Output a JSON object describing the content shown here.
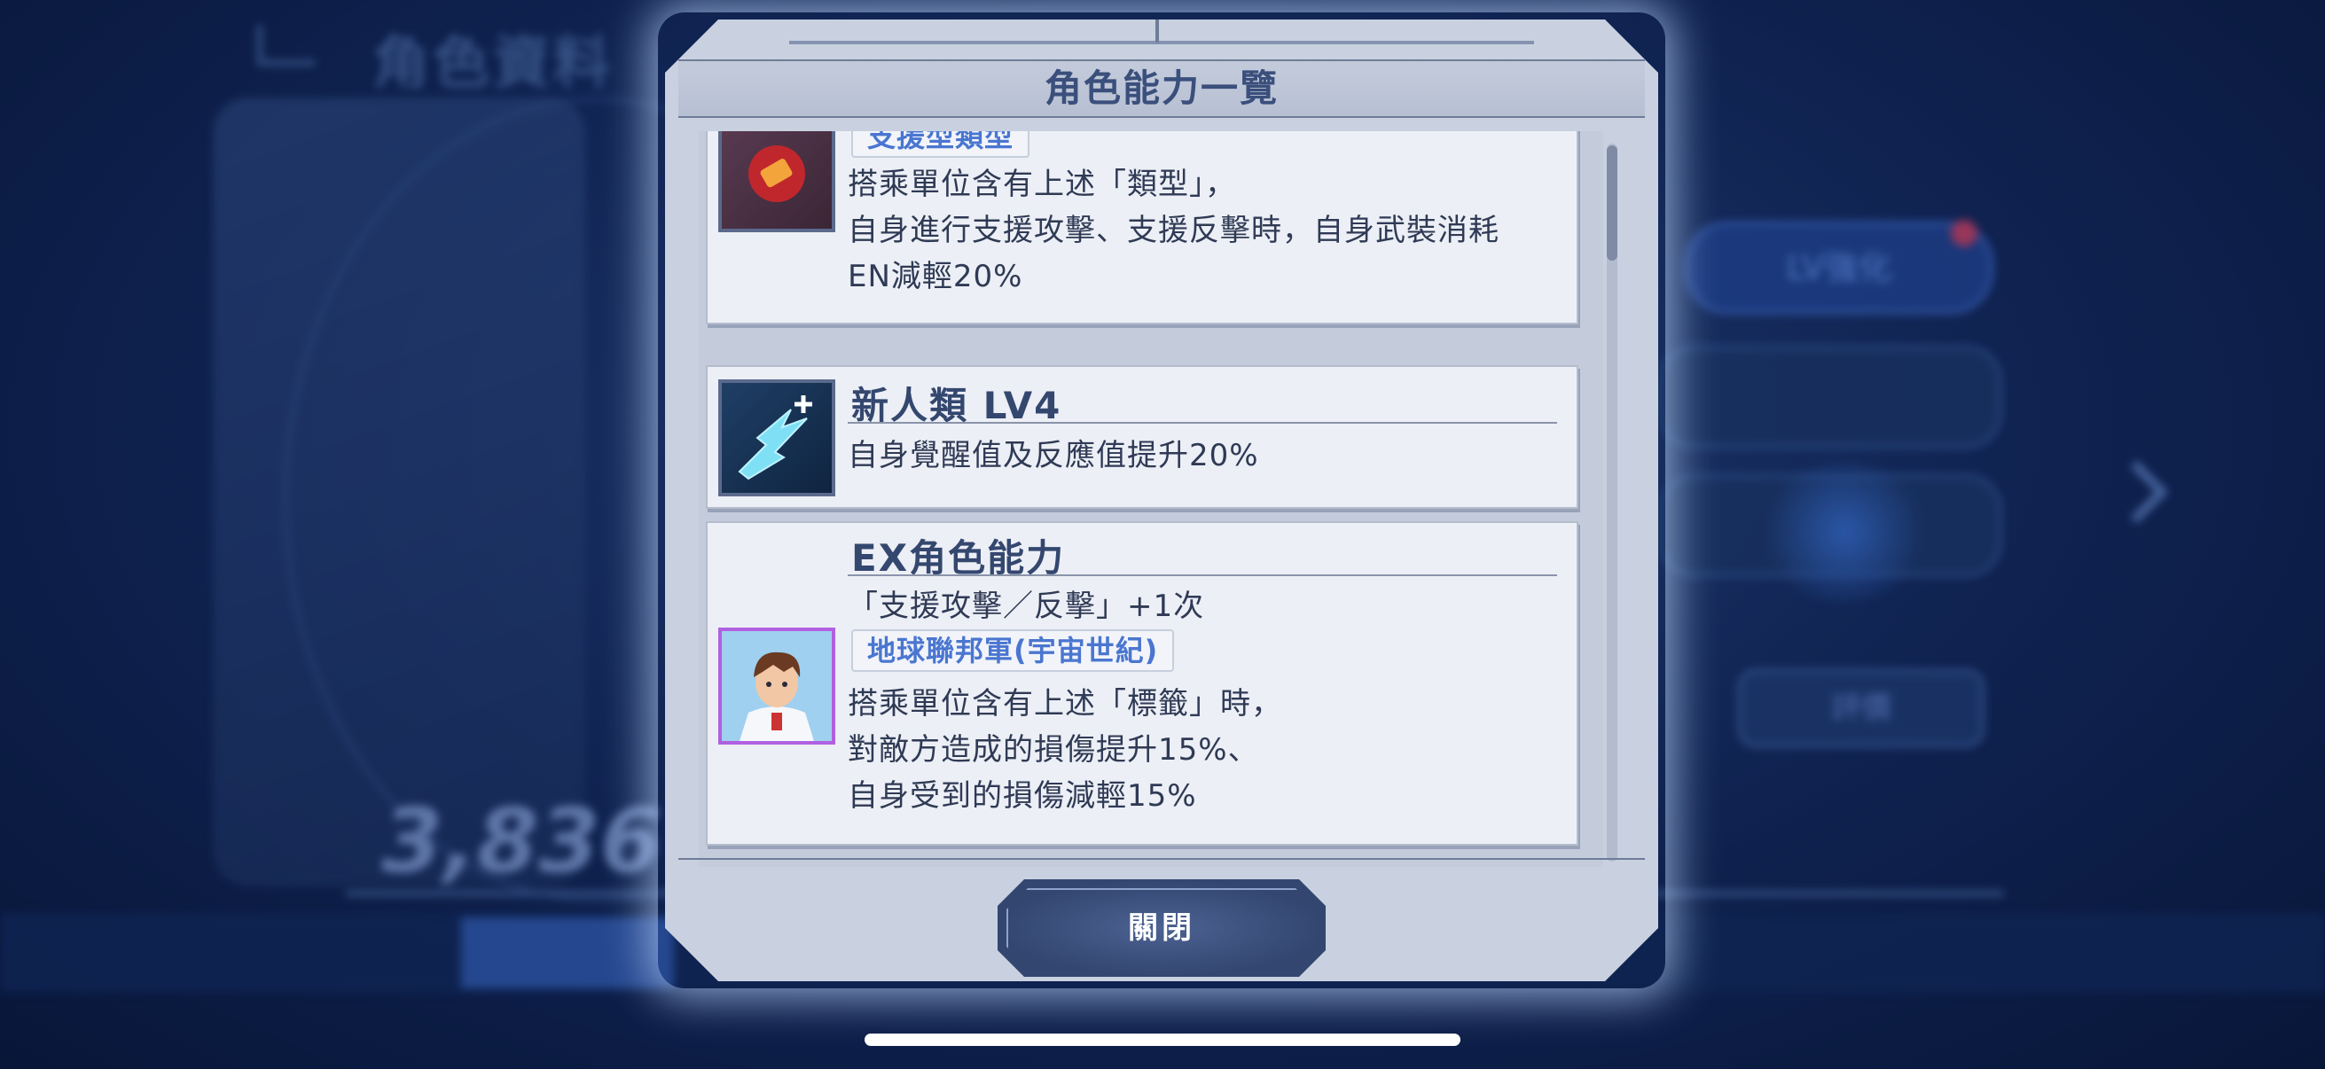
{
  "background": {
    "title": "角色資料",
    "power_value": "3,836",
    "lv_button": "LV強化",
    "search_button": "評價"
  },
  "dialog": {
    "title": "角色能力一覽",
    "close_label": "關閉",
    "abilities": [
      {
        "icon": "support-type-icon",
        "tag": "支援型類型",
        "lines": [
          "搭乘單位含有上述「類型」，",
          "自身進行支援攻擊、支援反擊時，自身武裝消耗",
          "EN減輕20%"
        ]
      },
      {
        "icon": "newtype-icon",
        "title": "新人類 LV4",
        "lines": [
          "自身覺醒值及反應值提升20%"
        ]
      },
      {
        "icon": "character-portrait-icon",
        "title": "EX角色能力",
        "line_before_tag": "「支援攻擊／反擊」+1次",
        "tag": "地球聯邦軍(宇宙世紀)",
        "lines": [
          "搭乘單位含有上述「標籤」時，",
          "對敵方造成的損傷提升15%、",
          "自身受到的損傷減輕15%"
        ]
      }
    ]
  },
  "colors": {
    "frame": "#c9d1e0",
    "title_text": "#3b4f7c",
    "tag_text": "#4a76d0",
    "button": "#324670"
  }
}
